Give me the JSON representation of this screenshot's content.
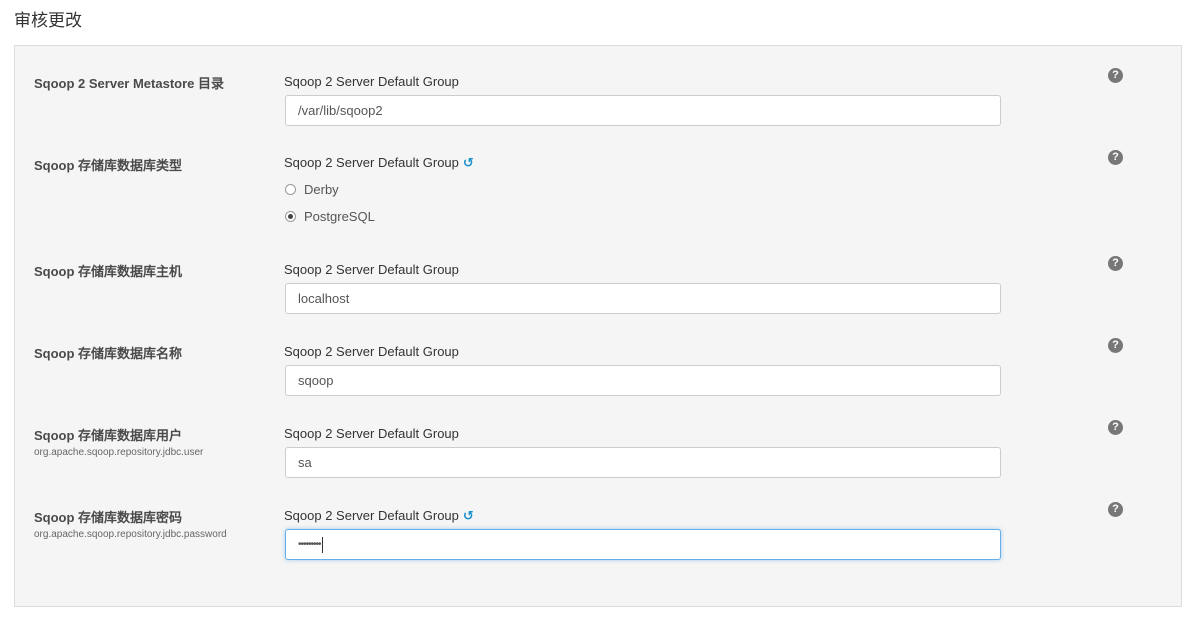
{
  "page": {
    "title": "审核更改"
  },
  "rows": [
    {
      "label": "Sqoop 2 Server Metastore 目录",
      "sublabel": "",
      "group": "Sqoop 2 Server Default Group",
      "value": "/var/lib/sqoop2"
    },
    {
      "label": "Sqoop 存储库数据库类型",
      "sublabel": "",
      "group": "Sqoop 2 Server Default Group",
      "options": [
        "Derby",
        "PostgreSQL"
      ],
      "selected": "PostgreSQL"
    },
    {
      "label": "Sqoop 存储库数据库主机",
      "sublabel": "",
      "group": "Sqoop 2 Server Default Group",
      "value": "localhost"
    },
    {
      "label": "Sqoop 存储库数据库名称",
      "sublabel": "",
      "group": "Sqoop 2 Server Default Group",
      "value": "sqoop"
    },
    {
      "label": "Sqoop 存储库数据库用户",
      "sublabel": "org.apache.sqoop.repository.jdbc.user",
      "group": "Sqoop 2 Server Default Group",
      "value": "sa"
    },
    {
      "label": "Sqoop 存储库数据库密码",
      "sublabel": "org.apache.sqoop.repository.jdbc.password",
      "group": "Sqoop 2 Server Default Group",
      "value": "•••••••••"
    }
  ],
  "icons": {
    "help": "?",
    "revert": "↺"
  },
  "colors": {
    "accent": "#1a8fc9",
    "panel_bg": "#f5f5f5",
    "help_icon": "#777777",
    "focus_border": "#66afe9"
  }
}
